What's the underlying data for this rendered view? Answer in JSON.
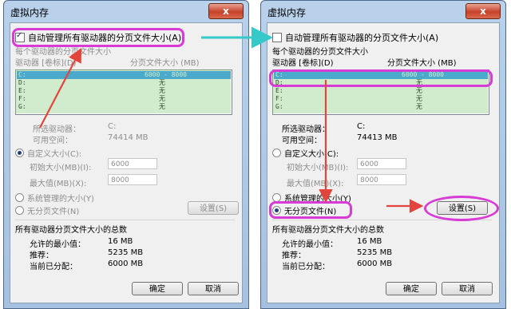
{
  "left_window": {
    "title": "虚拟内存",
    "close": "x",
    "auto_manage_label": "自动管理所有驱动器的分页文件大小(A)",
    "per_drive_label": "每个驱动器的分页文件大小",
    "col_drive": "驱动器 [卷标](D)",
    "col_size": "分页文件大小 (MB)",
    "drives": [
      {
        "drive": "C:",
        "size": "6000 - 8000"
      },
      {
        "drive": "D:",
        "size": "无"
      },
      {
        "drive": "E:",
        "size": "无"
      },
      {
        "drive": "F:",
        "size": "无"
      },
      {
        "drive": "G:",
        "size": "无"
      }
    ],
    "selected_drive_label": "所选驱动器：",
    "selected_drive_value": "C:",
    "free_space_label": "可用空间：",
    "free_space_value": "74414 MB",
    "custom_size_label": "自定义大小(C):",
    "initial_label": "初始大小(MB)(I):",
    "initial_value": "6000",
    "max_label": "最大值(MB)(X):",
    "max_value": "8000",
    "system_managed_label": "系统管理的大小(Y)",
    "no_paging_label": "无分页文件(N)",
    "set_button": "设置(S)",
    "total_group_label": "所有驱动器分页文件大小的总数",
    "min_allowed_label": "允许的最小值：",
    "min_allowed_value": "16 MB",
    "recommended_label": "推荐：",
    "recommended_value": "5235 MB",
    "current_label": "当前已分配：",
    "current_value": "6000 MB",
    "ok_button": "确定",
    "cancel_button": "取消"
  },
  "right_window": {
    "title": "虚拟内存",
    "close": "x",
    "auto_manage_label": "自动管理所有驱动器的分页文件大小(A)",
    "per_drive_label": "每个驱动器的分页文件大小",
    "col_drive": "驱动器 [卷标](D)",
    "col_size": "分页文件大小 (MB)",
    "drives": [
      {
        "drive": "C:",
        "size": "6000 - 8000"
      },
      {
        "drive": "D:",
        "size": "无"
      },
      {
        "drive": "E:",
        "size": "无"
      },
      {
        "drive": "F:",
        "size": "无"
      },
      {
        "drive": "G:",
        "size": "无"
      }
    ],
    "selected_drive_label": "所选驱动器：",
    "selected_drive_value": "C:",
    "free_space_label": "可用空间：",
    "free_space_value": "74413 MB",
    "custom_size_label": "自定义大小(C):",
    "initial_label": "初始大小(MB)(I):",
    "initial_value": "6000",
    "max_label": "最大值(MB)(X):",
    "max_value": "8000",
    "system_managed_label": "系统管理的大小(Y)",
    "no_paging_label": "无分页文件(N)",
    "set_button": "设置(S)",
    "total_group_label": "所有驱动器分页文件大小的总数",
    "min_allowed_label": "允许的最小值：",
    "min_allowed_value": "16 MB",
    "recommended_label": "推荐：",
    "recommended_value": "5235 MB",
    "current_label": "当前已分配：",
    "current_value": "6000 MB",
    "ok_button": "确定",
    "cancel_button": "取消"
  },
  "colors": {
    "annotation_ring": "#d83bd6",
    "annotation_arrow": "#e2453c",
    "connector_arrow": "#35c9c9"
  }
}
